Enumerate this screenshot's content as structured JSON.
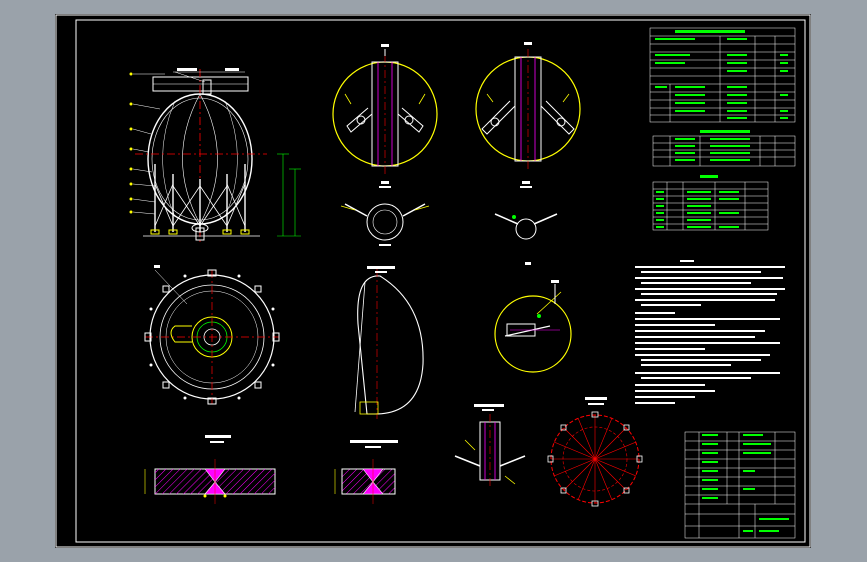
{
  "drawing": {
    "background": "#000000",
    "line_colors": {
      "border": "#ffffff",
      "outline": "#ffffff",
      "dimension": "#00ff00",
      "centerline": "#ff0000",
      "callout": "#ffff00",
      "pipe": "#ff00ff",
      "table": "#ffffff"
    }
  }
}
